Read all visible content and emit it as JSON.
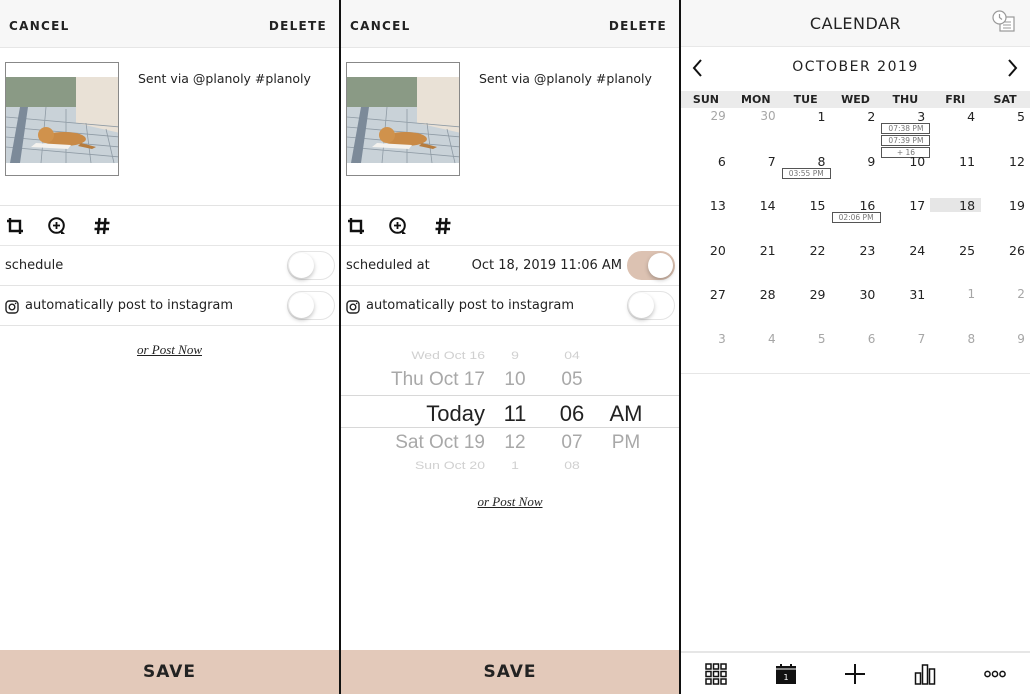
{
  "editor_unscheduled": {
    "cancel_label": "CANCEL",
    "delete_label": "DELETE",
    "caption": "Sent via @planoly #planoly",
    "tools": [
      "crop-icon",
      "zoom-in-icon",
      "hashtag-icon"
    ],
    "schedule": {
      "label": "schedule",
      "on": false
    },
    "auto_post": {
      "label": "automatically post to instagram",
      "on": false
    },
    "post_now_label": "or Post Now",
    "save_label": "SAVE"
  },
  "editor_scheduled": {
    "cancel_label": "CANCEL",
    "delete_label": "DELETE",
    "caption": "Sent via @planoly #planoly",
    "tools": [
      "crop-icon",
      "zoom-in-icon",
      "hashtag-icon"
    ],
    "schedule": {
      "label": "scheduled at",
      "value": "Oct 18, 2019 11:06 AM",
      "on": true
    },
    "auto_post": {
      "label": "automatically post to instagram",
      "on": false
    },
    "picker": {
      "dates": [
        "Wed Oct 16",
        "Thu Oct 17",
        "Today",
        "Sat Oct 19",
        "Sun Oct 20"
      ],
      "hours": [
        "9",
        "10",
        "11",
        "12",
        "1"
      ],
      "minutes": [
        "04",
        "05",
        "06",
        "07",
        "08"
      ],
      "meridiem": [
        "",
        "",
        "AM",
        "PM",
        ""
      ],
      "selected": {
        "date": "Today",
        "hour": "11",
        "minute": "06",
        "meridiem": "AM"
      }
    },
    "post_now_label": "or Post Now",
    "save_label": "SAVE"
  },
  "calendar": {
    "title": "CALENDAR",
    "history_icon": "schedule-history-icon",
    "month_label": "OCTOBER 2019",
    "weekdays": [
      "SUN",
      "MON",
      "TUE",
      "WED",
      "THU",
      "FRI",
      "SAT"
    ],
    "weeks": [
      [
        {
          "d": "29",
          "m": true
        },
        {
          "d": "30",
          "m": true
        },
        {
          "d": "1"
        },
        {
          "d": "2"
        },
        {
          "d": "3",
          "events": [
            "07:38 PM",
            "07:39 PM",
            "+ 16"
          ]
        },
        {
          "d": "4"
        },
        {
          "d": "5"
        }
      ],
      [
        {
          "d": "6"
        },
        {
          "d": "7"
        },
        {
          "d": "8",
          "events": [
            "03:55 PM"
          ]
        },
        {
          "d": "9"
        },
        {
          "d": "10"
        },
        {
          "d": "11"
        },
        {
          "d": "12"
        }
      ],
      [
        {
          "d": "13"
        },
        {
          "d": "14"
        },
        {
          "d": "15"
        },
        {
          "d": "16",
          "events": [
            "02:06 PM"
          ]
        },
        {
          "d": "17"
        },
        {
          "d": "18",
          "today": true
        },
        {
          "d": "19"
        }
      ],
      [
        {
          "d": "20"
        },
        {
          "d": "21"
        },
        {
          "d": "22"
        },
        {
          "d": "23"
        },
        {
          "d": "24"
        },
        {
          "d": "25"
        },
        {
          "d": "26"
        }
      ],
      [
        {
          "d": "27"
        },
        {
          "d": "28"
        },
        {
          "d": "29"
        },
        {
          "d": "30"
        },
        {
          "d": "31"
        },
        {
          "d": "1",
          "m": true
        },
        {
          "d": "2",
          "m": true
        }
      ],
      [
        {
          "d": "3",
          "m": true
        },
        {
          "d": "4",
          "m": true
        },
        {
          "d": "5",
          "m": true
        },
        {
          "d": "6",
          "m": true
        },
        {
          "d": "7",
          "m": true
        },
        {
          "d": "8",
          "m": true
        },
        {
          "d": "9",
          "m": true
        }
      ]
    ],
    "tabs": [
      "grid-icon",
      "calendar-icon",
      "plus-icon",
      "analytics-icon",
      "more-icon"
    ],
    "calendar_tab_day": "1"
  },
  "colors": {
    "accent": "#e3c9ba",
    "toggle_on": "#dcc2b2",
    "today_highlight": "#e6e6e6"
  }
}
